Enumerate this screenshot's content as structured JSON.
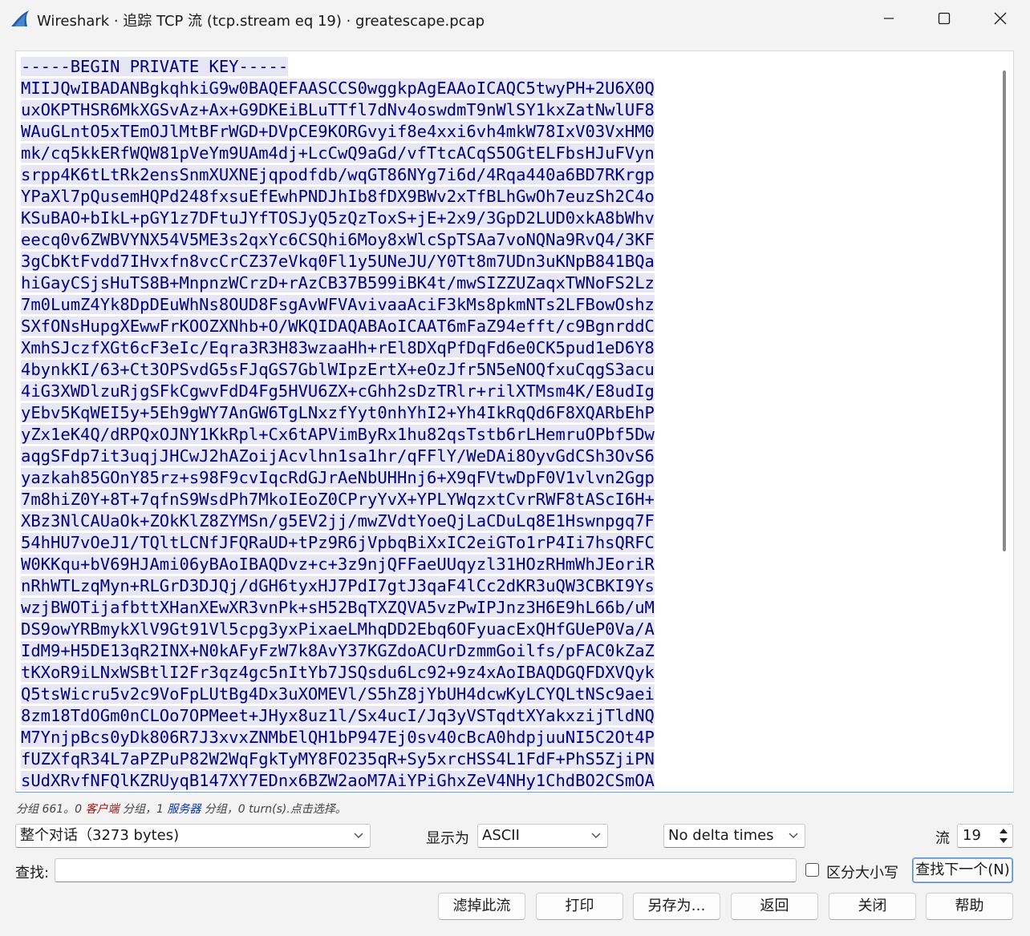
{
  "window": {
    "title": "Wireshark · 追踪 TCP 流 (tcp.stream eq 19) · greatescape.pcap"
  },
  "stream": {
    "lines": [
      "-----BEGIN PRIVATE KEY-----",
      "MIIJQwIBADANBgkqhkiG9w0BAQEFAASCCS0wggkpAgEAAoICAQC5twyPH+2U6X0Q",
      "uxOKPTHSR6MkXGSvAz+Ax+G9DKEiBLuTTfl7dNv4oswdmT9nWlSY1kxZatNwlUF8",
      "WAuGLntO5xTEmOJlMtBFrWGD+DVpCE9KORGvyif8e4xxi6vh4mkW78IxV03VxHM0",
      "mk/cq5kkERfWQW81pVeYm9UAm4dj+LcCwQ9aGd/vfTtcACqS5OGtELFbsHJuFVyn",
      "srpp4K6tLtRk2ensSnmXUXNEjqpodfdb/wqGT86NYg7i6d/4Rqa440a6BD7RKrgp",
      "YPaXl7pQusemHQPd248fxsuEfEwhPNDJhIb8fDX9BWv2xTfBLhGwOh7euzSh2C4o",
      "KSuBAO+bIkL+pGY1z7DFtuJYfTOSJyQ5zQzToxS+jE+2x9/3GpD2LUD0xkA8bWhv",
      "eecq0v6ZWBVYNX54V5ME3s2qxYc6CSQhi6Moy8xWlcSpTSAa7voNQNa9RvQ4/3KF",
      "3gCbKtFvdd7IHvxfn8vcCrCZ37eVkq0Fl1y5UNeJU/Y0Tt8m7UDn3uKNpB841BQa",
      "hiGayCSjsHuTS8B+MnpnzWCrzD+rAzCB37B599iBK4t/mwSIZZUZaqxTWNoFS2Lz",
      "7m0LumZ4Yk8DpDEuWhNs8OUD8FsgAvWFVAvivaaAciF3kMs8pkmNTs2LFBowOshz",
      "SXfONsHupgXEwwFrKOOZXNhb+O/WKQIDAQABAoICAAT6mFaZ94efft/c9BgnrddC",
      "XmhSJczfXGt6cF3eIc/Eqra3R3H83wzaaHh+rEl8DXqPfDqFd6e0CK5pud1eD6Y8",
      "4bynkKI/63+Ct3OPSvdG5sFJqGS7GblWIpzErtX+eOzJfr5N5eNOQfxuCqgS3acu",
      "4iG3XWDlzuRjgSFkCgwvFdD4Fg5HVU6ZX+cGhh2sDzTRlr+rilXTMsm4K/E8udIg",
      "yEbv5KqWEI5y+5Eh9gWY7AnGW6TgLNxzfYyt0nhYhI2+Yh4IkRqQd6F8XQARbEhP",
      "yZx1eK4Q/dRPQxOJNY1KkRpl+Cx6tAPVimByRx1hu82qsTstb6rLHemruOPbf5Dw",
      "aqgSFdp7it3uqjJHCwJ2hAZoijAcvlhn1sa1hr/qFFlY/WeDAi8OyvGdCSh3OvS6",
      "yazkah85GOnY85rz+s98F9cvIqcRdGJrAeNbUHHnj6+X9qFVtwDpF0V1vlvn2Ggp",
      "7m8hiZ0Y+8T+7qfnS9WsdPh7MkoIEoZ0CPryYvX+YPLYWqzxtCvrRWF8tAScI6H+",
      "XBz3NlCAUaOk+ZOkKlZ8ZYMSn/g5EV2jj/mwZVdtYoeQjLaCDuLq8E1Hswnpgq7F",
      "54hHU7vOeJ1/TQltLCNfJFQRaUD+tPz9R6jVpbqBiXxIC2eiGTo1rP4Ii7hsQRFC",
      "W0KKqu+bV69HJAmi06yBAoIBAQDvz+c+3z9njQFFaeUUqyzl31HOzRHmWhJEoriR",
      "nRhWTLzqMyn+RLGrD3DJQj/dGH6tyxHJ7PdI7gtJ3qaF4lCc2dKR3uQW3CBKI9Ys",
      "wzjBWOTijafbttXHanXEwXR3vnPk+sH52BqTXZQVA5vzPwIPJnz3H6E9hL66b/uM",
      "DS9owYRBmykXlV9Gt91Vl5cpg3yxPixaeLMhqDD2Ebq6OFyuacExQHfGUeP0Va/A",
      "IdM9+H5DE13qR2INX+N0kAFyFzW7k8AvY37KGZdoACUrDzmmGoilfs/pFAC0kZaZ",
      "tKXoR9iLNxWSBtlI2Fr3qz4gc5nItYb7JSQsdu6Lc92+9z4xAoIBAQDGQFDXVQyk",
      "Q5tsWicru5v2c9VoFpLUtBg4Dx3uXOMEVl/S5hZ8jYbUH4dcwKyLCYQLtNSc9aei",
      "8zm18TdOGm0nCLOo7OPMeet+JHyx8uz1l/Sx4ucI/Jq3yVSTqdtXYakxzijTldNQ",
      "M7YnjpBcs0yDk806R7J3xvxZNMbElQH1bP947Ej0sv40cBcA0hdpjuuNI5C2Ot4P",
      "fUZXfqR34L7aPZPuP82W2WqFgkTyMY8FO235qR+Sy5xrcHSS4L1FdF+PhS5ZjiPN",
      "sUdXRvfNFQlKZRUyqB147XY7EDnx6BZW2aoM7AiYPiGhxZeV4NHy1ChdBO2CSmOA"
    ]
  },
  "info": {
    "p1": "分组 661。0 ",
    "client": "客户端",
    "p2": " 分组，1 ",
    "server": "服务器",
    "p3": " 分组，0 turn(s).点击选择。"
  },
  "controls": {
    "conversation": "整个对话（3273 bytes)",
    "show_as_label": "显示为",
    "show_as_value": "ASCII",
    "delta": "No delta times",
    "stream_label": "流",
    "stream_value": "19",
    "find_label": "查找:",
    "find_value": "",
    "case_label": "区分大小写",
    "find_next": "查找下一个(N)"
  },
  "buttons": {
    "filter_out": "滤掉此流",
    "print": "打印",
    "save_as": "另存为…",
    "back": "返回",
    "close": "关闭",
    "help": "帮助"
  }
}
